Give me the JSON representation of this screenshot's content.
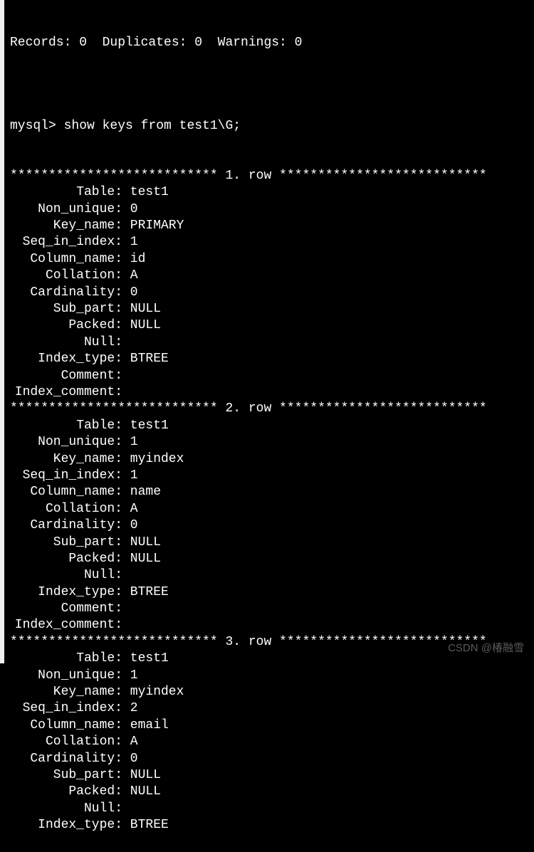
{
  "header_cut": "Records: 0  Duplicates: 0  Warnings: 0",
  "blank": "",
  "prompt": "mysql> ",
  "command": "show keys from test1\\G;",
  "sep_left": "*************************** ",
  "sep_right": " ***************************",
  "rows": [
    {
      "num": "1. row",
      "fields": [
        {
          "k": "Table",
          "v": "test1"
        },
        {
          "k": "Non_unique",
          "v": "0"
        },
        {
          "k": "Key_name",
          "v": "PRIMARY"
        },
        {
          "k": "Seq_in_index",
          "v": "1"
        },
        {
          "k": "Column_name",
          "v": "id"
        },
        {
          "k": "Collation",
          "v": "A"
        },
        {
          "k": "Cardinality",
          "v": "0"
        },
        {
          "k": "Sub_part",
          "v": "NULL"
        },
        {
          "k": "Packed",
          "v": "NULL"
        },
        {
          "k": "Null",
          "v": ""
        },
        {
          "k": "Index_type",
          "v": "BTREE"
        },
        {
          "k": "Comment",
          "v": ""
        },
        {
          "k": "Index_comment",
          "v": ""
        }
      ]
    },
    {
      "num": "2. row",
      "fields": [
        {
          "k": "Table",
          "v": "test1"
        },
        {
          "k": "Non_unique",
          "v": "1"
        },
        {
          "k": "Key_name",
          "v": "myindex"
        },
        {
          "k": "Seq_in_index",
          "v": "1"
        },
        {
          "k": "Column_name",
          "v": "name"
        },
        {
          "k": "Collation",
          "v": "A"
        },
        {
          "k": "Cardinality",
          "v": "0"
        },
        {
          "k": "Sub_part",
          "v": "NULL"
        },
        {
          "k": "Packed",
          "v": "NULL"
        },
        {
          "k": "Null",
          "v": ""
        },
        {
          "k": "Index_type",
          "v": "BTREE"
        },
        {
          "k": "Comment",
          "v": ""
        },
        {
          "k": "Index_comment",
          "v": ""
        }
      ]
    },
    {
      "num": "3. row",
      "fields": [
        {
          "k": "Table",
          "v": "test1"
        },
        {
          "k": "Non_unique",
          "v": "1"
        },
        {
          "k": "Key_name",
          "v": "myindex"
        },
        {
          "k": "Seq_in_index",
          "v": "2"
        },
        {
          "k": "Column_name",
          "v": "email"
        },
        {
          "k": "Collation",
          "v": "A"
        },
        {
          "k": "Cardinality",
          "v": "0"
        },
        {
          "k": "Sub_part",
          "v": "NULL"
        },
        {
          "k": "Packed",
          "v": "NULL"
        },
        {
          "k": "Null",
          "v": ""
        },
        {
          "k": "Index_type",
          "v": "BTREE"
        }
      ]
    }
  ],
  "watermark": "CSDN @椿融雪"
}
